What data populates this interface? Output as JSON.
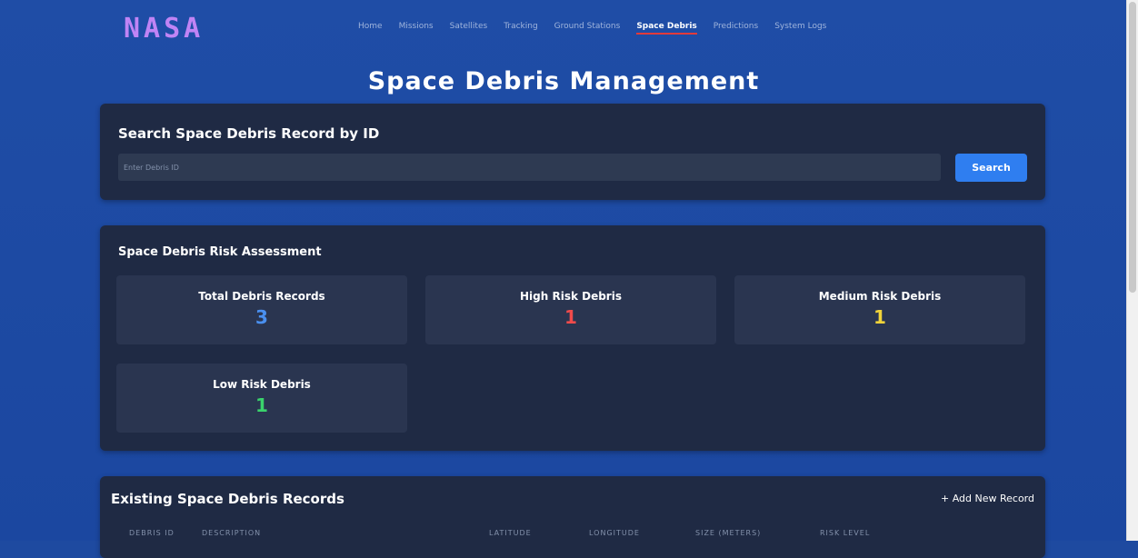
{
  "logo": "NASA",
  "nav": [
    {
      "label": "Home",
      "active": false
    },
    {
      "label": "Missions",
      "active": false
    },
    {
      "label": "Satellites",
      "active": false
    },
    {
      "label": "Tracking",
      "active": false
    },
    {
      "label": "Ground Stations",
      "active": false
    },
    {
      "label": "Space Debris",
      "active": true
    },
    {
      "label": "Predictions",
      "active": false
    },
    {
      "label": "System Logs",
      "active": false
    }
  ],
  "page_title": "Space Debris Management",
  "search": {
    "heading": "Search Space Debris Record by ID",
    "placeholder": "Enter Debris ID",
    "button_label": "Search"
  },
  "risk": {
    "heading": "Space Debris Risk Assessment",
    "cards": [
      {
        "label": "Total Debris Records",
        "value": "3",
        "color": "#4a90f0"
      },
      {
        "label": "High Risk Debris",
        "value": "1",
        "color": "#f04b4b"
      },
      {
        "label": "Medium Risk Debris",
        "value": "1",
        "color": "#f0d33a"
      },
      {
        "label": "Low Risk Debris",
        "value": "1",
        "color": "#3ad36c"
      }
    ]
  },
  "records": {
    "heading": "Existing Space Debris Records",
    "add_label": "+ Add New Record",
    "columns": [
      "DEBRIS ID",
      "DESCRIPTION",
      "LATITUDE",
      "LONGITUDE",
      "SIZE (METERS)",
      "RISK LEVEL"
    ]
  }
}
